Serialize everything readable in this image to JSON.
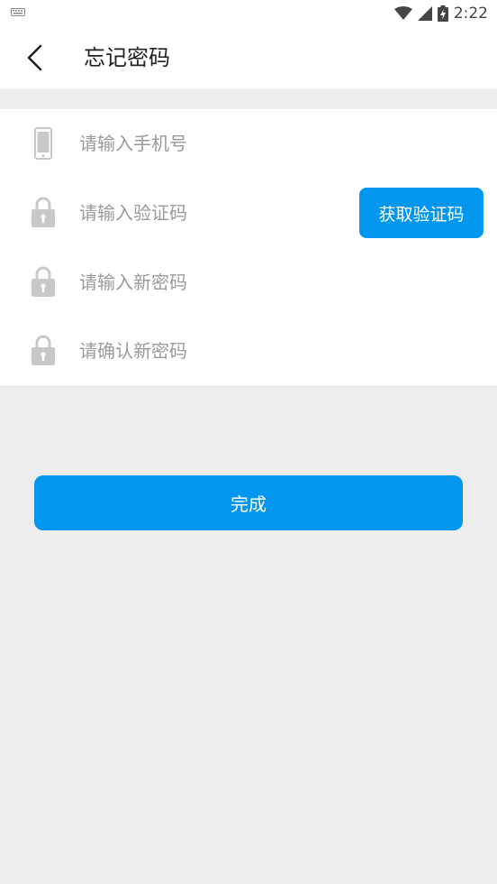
{
  "status_bar": {
    "time": "2:22",
    "icons": [
      "keyboard-icon",
      "wifi-icon",
      "signal-icon",
      "battery-icon"
    ]
  },
  "header": {
    "back_icon": "chevron-left-icon",
    "title": "忘记密码"
  },
  "form": {
    "phone": {
      "icon": "phone-icon",
      "placeholder": "请输入手机号",
      "value": ""
    },
    "code": {
      "icon": "lock-icon",
      "placeholder": "请输入验证码",
      "value": ""
    },
    "new_password": {
      "icon": "lock-icon",
      "placeholder": "请输入新密码",
      "value": ""
    },
    "confirm_password": {
      "icon": "lock-icon",
      "placeholder": "请确认新密码",
      "value": ""
    },
    "get_code_label": "获取验证码"
  },
  "submit_label": "完成",
  "colors": {
    "accent": "#0396ee",
    "background": "#ededed",
    "icon_gray": "#c8c8c8"
  }
}
